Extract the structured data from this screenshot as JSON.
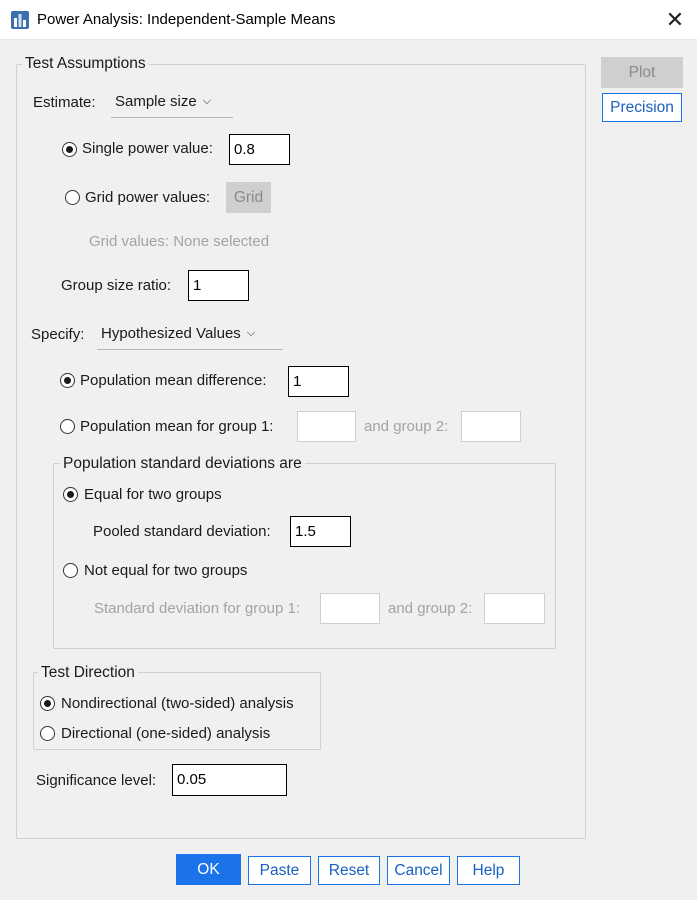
{
  "window": {
    "title": "Power Analysis: Independent-Sample Means",
    "close_glyph": "✕"
  },
  "side_buttons": {
    "plot": "Plot",
    "precision": "Precision"
  },
  "test_assumptions": {
    "legend": "Test Assumptions",
    "estimate_label": "Estimate:",
    "estimate_value": "Sample size",
    "single_power_label": "Single power value:",
    "single_power_value": "0.8",
    "grid_power_label": "Grid power values:",
    "grid_button": "Grid",
    "grid_values_text": "Grid values: None selected",
    "group_size_ratio_label": "Group size ratio:",
    "group_size_ratio_value": "1",
    "specify_label": "Specify:",
    "specify_value": "Hypothesized Values",
    "pop_mean_diff_label": "Population mean difference:",
    "pop_mean_diff_value": "1",
    "pop_mean_group1_label": "Population mean for group 1:",
    "and_group2_label": "and group 2:",
    "std_dev": {
      "legend": "Population standard deviations are",
      "equal_label": "Equal for two groups",
      "pooled_label": "Pooled standard deviation:",
      "pooled_value": "1.5",
      "not_equal_label": "Not equal for two groups",
      "sd_group1_label": "Standard deviation for group 1:",
      "and_group2_label": "and group 2:"
    },
    "test_direction": {
      "legend": "Test Direction",
      "nondirectional_label": "Nondirectional (two-sided) analysis",
      "directional_label": "Directional (one-sided) analysis"
    },
    "significance_label": "Significance level:",
    "significance_value": "0.05"
  },
  "footer": {
    "ok": "OK",
    "paste": "Paste",
    "reset": "Reset",
    "cancel": "Cancel",
    "help": "Help"
  }
}
